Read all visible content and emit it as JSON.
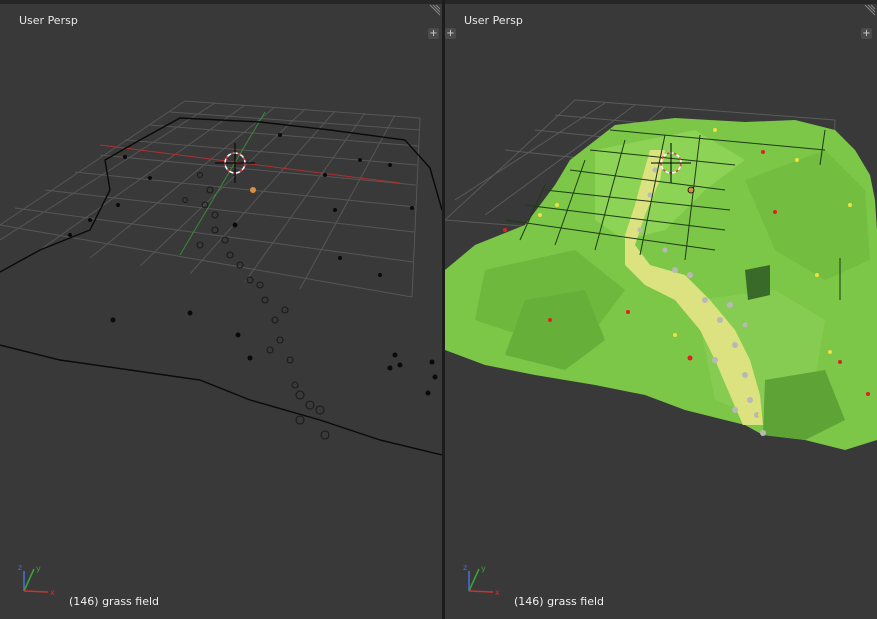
{
  "viewports": {
    "left": {
      "title": "User Persp",
      "status": "(146) grass field",
      "shading": "wireframe",
      "add_region_icon": "plus-icon",
      "corner_icon": "area-split-corner-icon"
    },
    "right": {
      "title": "User Persp",
      "status": "(146) grass field",
      "shading": "solid",
      "add_region_icon": "plus-icon",
      "corner_icon": "area-split-corner-icon"
    }
  },
  "gizmo": {
    "x_label": "x",
    "y_label": "y",
    "z_label": "z"
  },
  "colors": {
    "viewport_bg": "#393939",
    "grid": "#5a5a5a",
    "x_axis": "#c03030",
    "y_axis": "#3a9a3a",
    "grass_light": "#8dd45a",
    "grass_dark": "#5fa33a",
    "path": "#d8e08a",
    "stone": "#b0b0b0",
    "flower_red": "#e02020",
    "flower_yellow": "#f0e040"
  }
}
